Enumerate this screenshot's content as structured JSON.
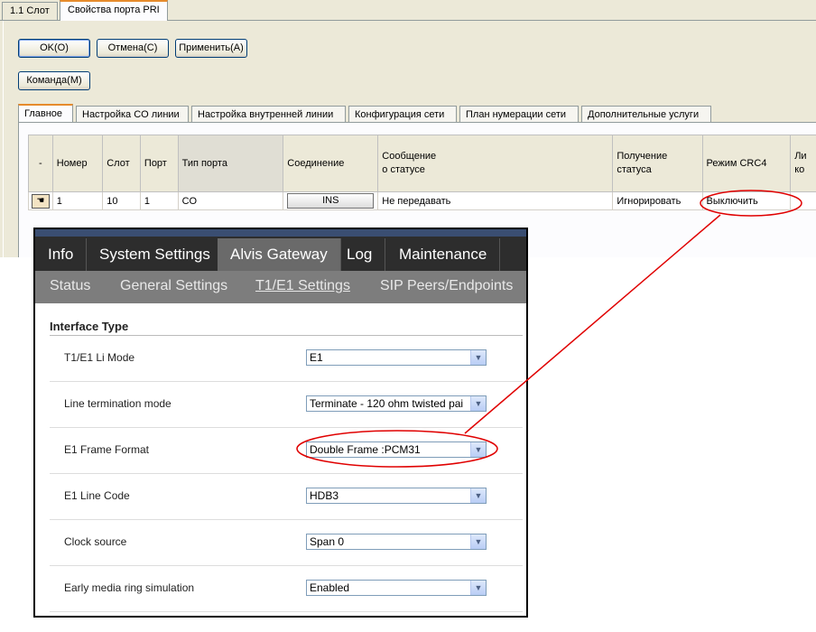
{
  "window": {
    "top_tabs": [
      "1.1 Слот",
      "Свойства порта PRI"
    ],
    "buttons": {
      "ok": "OK(O)",
      "cancel": "Отмена(C)",
      "apply": "Применить(A)",
      "command": "Команда(M)"
    },
    "inner_tabs": [
      "Главное",
      "Настройка CO линии",
      "Настройка внутренней линии",
      "Конфигурация сети",
      "План нумерации сети",
      "Дополнительные услуги"
    ],
    "grid": {
      "headers": [
        "-",
        "Номер",
        "Слот",
        "Порт",
        "Тип порта",
        "Соединение",
        "Сообщение о статусе",
        "Получение статуса",
        "Режим CRC4",
        "Ли ко"
      ],
      "row": {
        "number": "1",
        "slot": "10",
        "port": "1",
        "type": "CO",
        "connection": "INS",
        "status_message": "Не передавать",
        "status_receive": "Игнорировать",
        "crc4": "Выключить"
      }
    }
  },
  "gateway": {
    "tabs": [
      "Info",
      "System Settings",
      "Alvis Gateway",
      "Log",
      "Maintenance"
    ],
    "active_tab": "Alvis Gateway",
    "subtabs": [
      "Status",
      "General Settings",
      "T1/E1 Settings",
      "SIP Peers/Endpoints"
    ],
    "active_subtab": "T1/E1 Settings",
    "section_title": "Interface Type",
    "settings": [
      {
        "label": "T1/E1 Li Mode",
        "value": "E1"
      },
      {
        "label": "Line termination mode",
        "value": "Terminate - 120 ohm twisted pai"
      },
      {
        "label": "E1 Frame Format",
        "value": "Double Frame :PCM31"
      },
      {
        "label": "E1 Line Code",
        "value": "HDB3"
      },
      {
        "label": "Clock source",
        "value": "Span 0"
      },
      {
        "label": "Early media ring simulation",
        "value": "Enabled"
      }
    ]
  },
  "colors": {
    "annotation": "#e00000",
    "tab_accent": "#e68b2c",
    "gateway_bar": "#2d2d2d"
  },
  "icons": {
    "row_marker": "hand-pointer-icon",
    "select_arrow": "chevron-down-icon"
  }
}
